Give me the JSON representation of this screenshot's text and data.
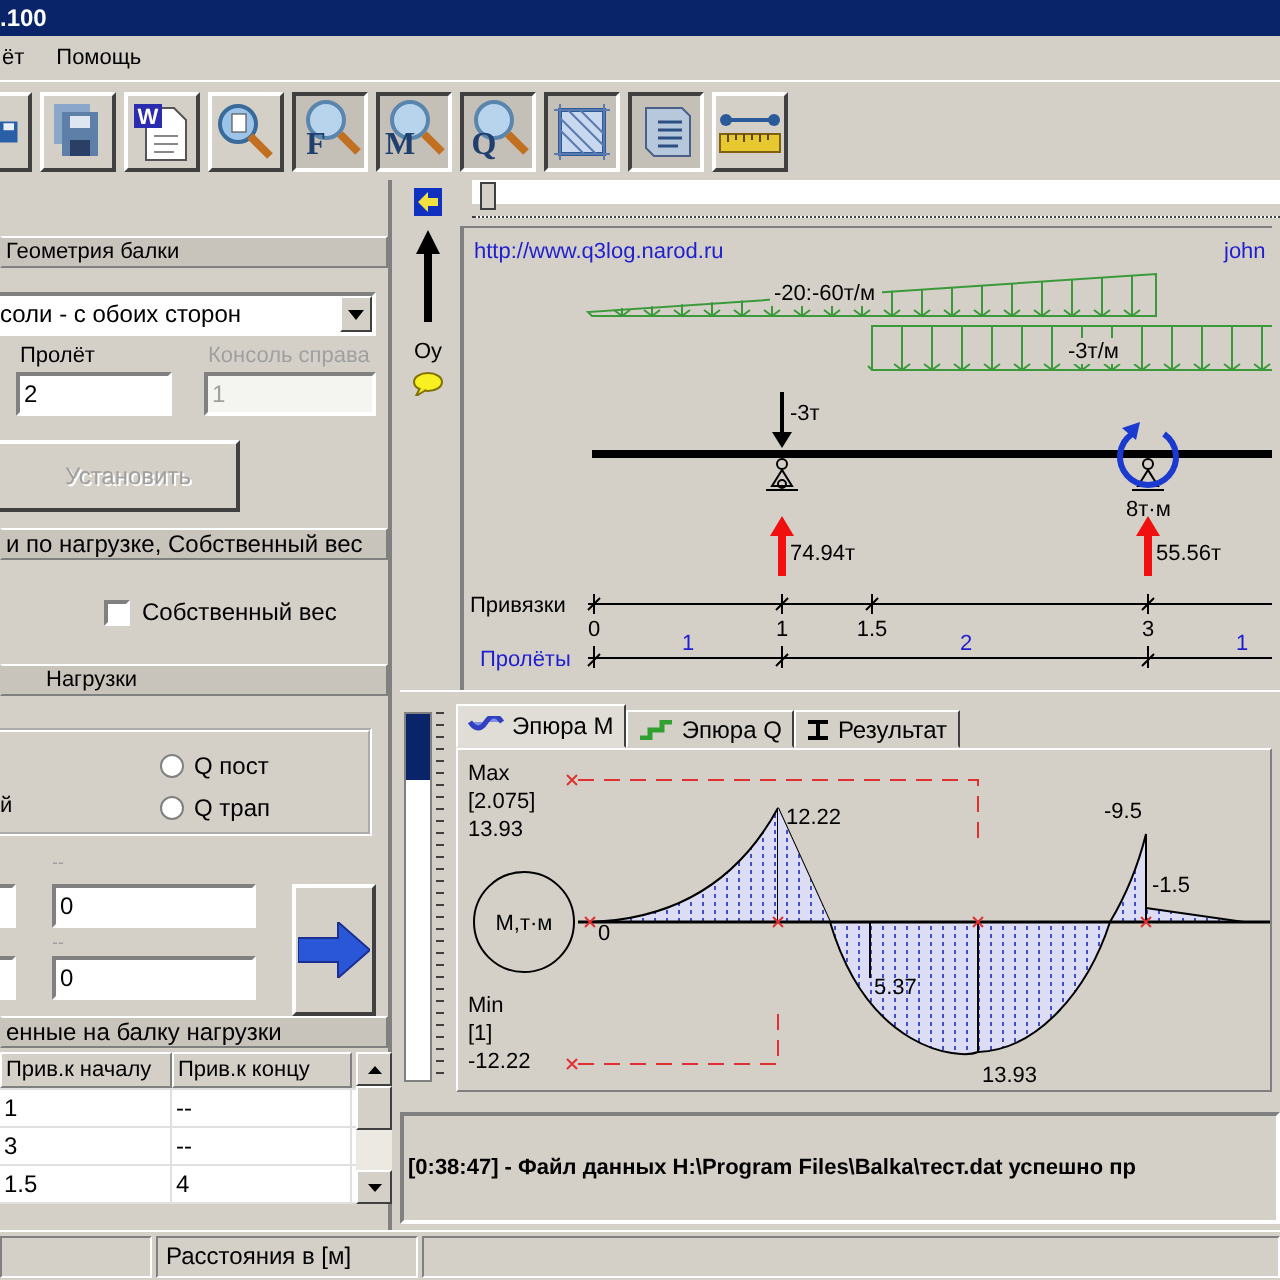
{
  "window": {
    "title": ".100"
  },
  "menu": [
    {
      "label": "ёт"
    },
    {
      "label": "Помощь"
    }
  ],
  "toolbar": [
    {
      "pressed": false
    },
    {
      "pressed": false
    },
    {
      "label": "W",
      "pressed": false
    },
    {
      "pressed": false
    },
    {
      "label": "F",
      "pressed": true
    },
    {
      "label": "M",
      "pressed": true
    },
    {
      "label": "Q",
      "pressed": true
    },
    {
      "pressed": true
    },
    {
      "pressed": true
    },
    {
      "pressed": false
    }
  ],
  "geometry": {
    "header": "Геометрия балки",
    "beam_type": "соли - с обоих сторон",
    "span_label": "Пролёт",
    "span_value": "2",
    "console_label": "Консоль справа",
    "console_value": "1",
    "console_disabled": true,
    "apply_button": {
      "label": "Установить",
      "disabled": true
    }
  },
  "weight": {
    "header": "и по нагрузке, Собственный вес",
    "checkbox": {
      "label": "Собственный вес",
      "checked": false
    }
  },
  "loads": {
    "header": "Нагрузки",
    "cut_label": "й",
    "radios": [
      {
        "label": "Q пост",
        "selected": false
      },
      {
        "label": "Q трап",
        "selected": false
      }
    ],
    "fields": [
      {
        "label": "--",
        "value": "0"
      },
      {
        "label": "--",
        "value": "0"
      }
    ]
  },
  "applied": {
    "header": "енные на балку нагрузки",
    "columns": [
      "Прив.к началу",
      "Прив.к концу"
    ],
    "rows": [
      [
        "1",
        "--"
      ],
      [
        "3",
        "--"
      ],
      [
        "1.5",
        "4"
      ]
    ]
  },
  "axis_panel": {
    "label": "Оу"
  },
  "scheme": {
    "url": "http://www.q3log.narod.ru",
    "author": "john",
    "distributed_loads": [
      "-20:-60т/м",
      "-3т/м"
    ],
    "point_force": "-3т",
    "moment": "8т·м",
    "reactions": [
      "74.94т",
      "55.56т"
    ],
    "bindings": {
      "label": "Привязки",
      "ticks": [
        "0",
        "1",
        "1.5",
        "3"
      ]
    },
    "spans": {
      "label": "Пролёты",
      "values": [
        "1",
        "2",
        "1"
      ]
    }
  },
  "zoom_slider": {
    "level": 0.18
  },
  "tabs": [
    {
      "label": "Эпюра M",
      "selected": true
    },
    {
      "label": "Эпюра Q",
      "selected": false
    },
    {
      "label": "Результат",
      "selected": false
    }
  ],
  "diagram": {
    "max": {
      "label": "Max",
      "position": "[2.075]",
      "value": "13.93"
    },
    "min": {
      "label": "Min",
      "position": "[1]",
      "value": "-12.22"
    },
    "unit": "М,т·м",
    "values": [
      "0",
      "12.22",
      "5.37",
      "13.93",
      "-9.5",
      "-1.5"
    ]
  },
  "log": "[0:38:47] - Файл данных H:\\Program Files\\Balka\\тест.dat успешно пр",
  "status_bar": [
    {
      "text": "Расстояния в [м]"
    }
  ]
}
